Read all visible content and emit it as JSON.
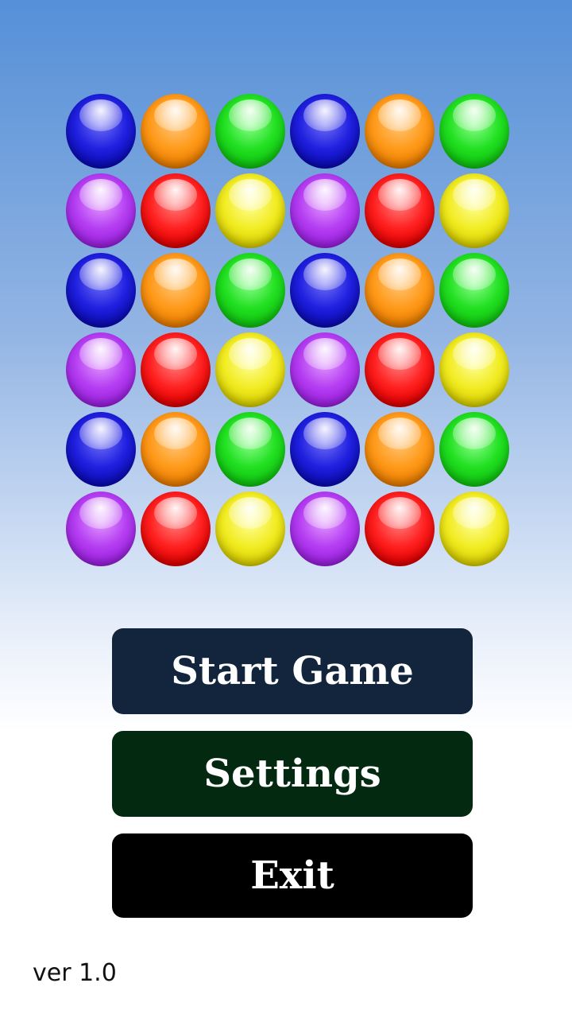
{
  "board": {
    "rows": [
      [
        "blue",
        "orange",
        "green",
        "blue",
        "orange",
        "green"
      ],
      [
        "purple",
        "red",
        "yellow",
        "purple",
        "red",
        "yellow"
      ],
      [
        "blue",
        "orange",
        "green",
        "blue",
        "orange",
        "green"
      ],
      [
        "purple",
        "red",
        "yellow",
        "purple",
        "red",
        "yellow"
      ],
      [
        "blue",
        "orange",
        "green",
        "blue",
        "orange",
        "green"
      ],
      [
        "purple",
        "red",
        "yellow",
        "purple",
        "red",
        "yellow"
      ]
    ]
  },
  "menu": {
    "start_label": "Start Game",
    "settings_label": "Settings",
    "exit_label": "Exit"
  },
  "colors": {
    "start_button": "#13253d",
    "settings_button": "#032a10",
    "exit_button": "#000000"
  },
  "footer": {
    "version": "ver 1.0"
  }
}
